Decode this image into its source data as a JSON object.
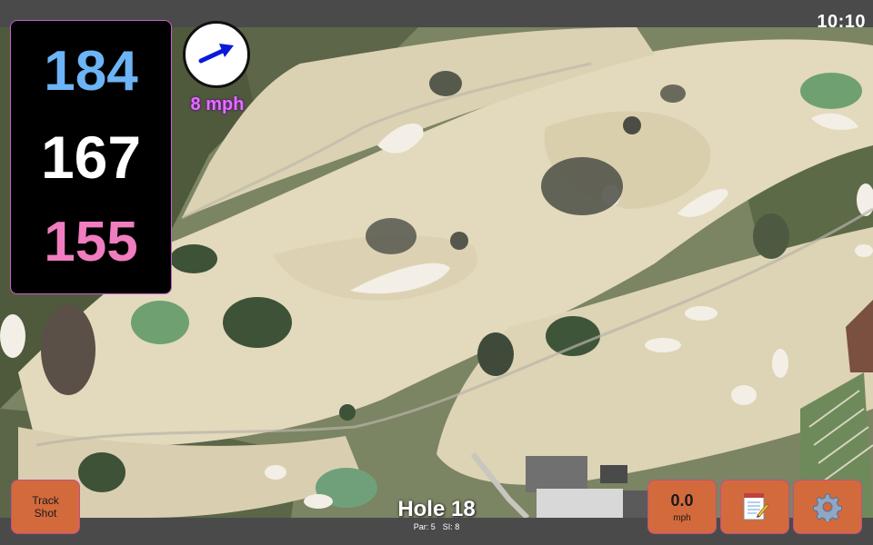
{
  "status_bar": {
    "time": "10:10"
  },
  "distances": {
    "back": "184",
    "center": "167",
    "front": "155"
  },
  "wind": {
    "speed": "8 mph",
    "direction_icon": "arrow-icon"
  },
  "hole": {
    "title": "Hole 18",
    "par_label": "Par: 5",
    "si_label": "SI: 8"
  },
  "buttons": {
    "track_shot_line1": "Track",
    "track_shot_line2": "Shot",
    "speed_value": "0.0",
    "speed_unit": "mph",
    "notes_icon": "notepad-icon",
    "settings_icon": "gear-icon"
  },
  "colors": {
    "back_distance": "#6cb4f5",
    "center_distance": "#ffffff",
    "front_distance": "#f07dc0",
    "button_fill": "#d26a3c",
    "wind_text": "#e070ff"
  }
}
